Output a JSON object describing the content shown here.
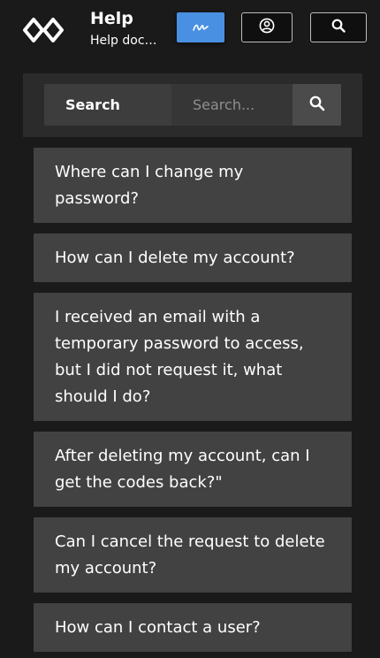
{
  "header": {
    "title": "Help",
    "subtitle": "Help doc…",
    "logo_icon": "link-chain-icon",
    "buttons": {
      "signature": {
        "icon": "signature-icon",
        "color": "#4a90e2"
      },
      "account": {
        "icon": "user-circle-icon"
      },
      "search": {
        "icon": "search-icon"
      }
    }
  },
  "search": {
    "label": "Search",
    "placeholder": "Search...",
    "button_icon": "search-icon"
  },
  "faq": {
    "items": [
      {
        "question": "Where can I change my password?"
      },
      {
        "question": "How can I delete my account?"
      },
      {
        "question": "I received an email with a temporary password to access, but I did not request it, what should I do?"
      },
      {
        "question": "After deleting my account, can I get the codes back?\""
      },
      {
        "question": "Can I cancel the request to delete my account?"
      },
      {
        "question": "How can I contact a user?"
      }
    ]
  },
  "colors": {
    "background": "#1a1a1a",
    "panel": "#2b2b2b",
    "item": "#424242",
    "accent": "#4a90e2"
  }
}
